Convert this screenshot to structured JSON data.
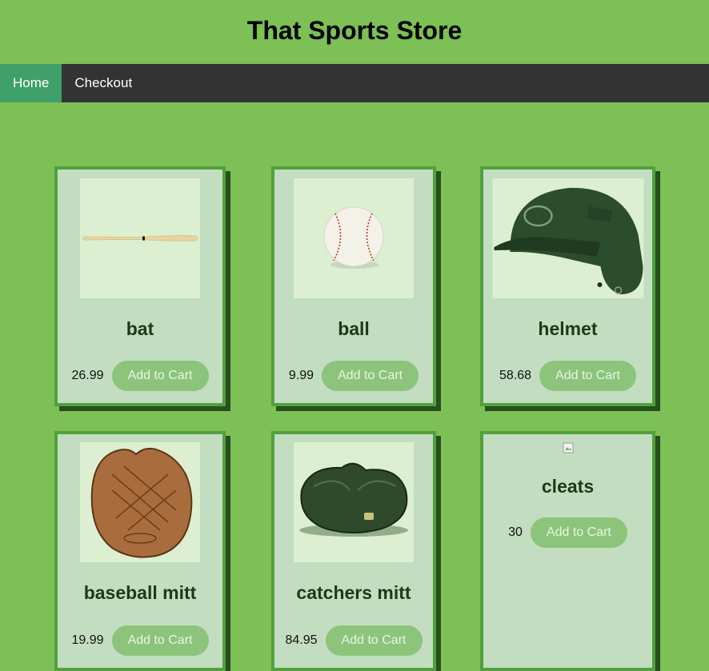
{
  "site": {
    "title": "That Sports Store"
  },
  "nav": {
    "home": "Home",
    "checkout": "Checkout"
  },
  "products": [
    {
      "name": "bat",
      "price": "26.99",
      "button": "Add to Cart"
    },
    {
      "name": "ball",
      "price": "9.99",
      "button": "Add to Cart"
    },
    {
      "name": "helmet",
      "price": "58.68",
      "button": "Add to Cart"
    },
    {
      "name": "baseball mitt",
      "price": "19.99",
      "button": "Add to Cart"
    },
    {
      "name": "catchers mitt",
      "price": "84.95",
      "button": "Add to Cart"
    },
    {
      "name": "cleats",
      "price": "30",
      "button": "Add to Cart"
    }
  ],
  "colors": {
    "page_bg": "#7cc056",
    "navbar_bg": "#333333",
    "nav_active": "#40a06a",
    "card_bg": "#c3ddc0",
    "card_border": "#52a03e",
    "button_bg": "#8cc47c"
  }
}
